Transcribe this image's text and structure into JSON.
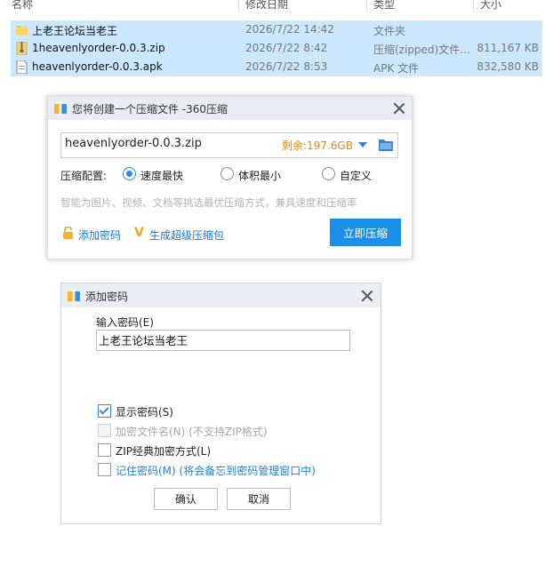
{
  "explorer": {
    "columns": [
      "名称",
      "修改日期",
      "类型",
      "大小"
    ],
    "rows": [
      {
        "name": "上老王论坛当老王",
        "date": "2026/7/22 14:42",
        "type": "文件夹",
        "size": "",
        "icon": "folder-icon"
      },
      {
        "name": "1heavenlyorder-0.0.3.zip",
        "date": "2026/7/22 8:42",
        "type": "压缩(zipped)文件...",
        "size": "811,167 KB",
        "icon": "zip-file-icon"
      },
      {
        "name": "heavenlyorder-0.0.3.apk",
        "date": "2026/7/22 8:53",
        "type": "APK 文件",
        "size": "832,580 KB",
        "icon": "apk-file-icon"
      }
    ]
  },
  "compress_dialog": {
    "title": "您将创建一个压缩文件 -360压缩",
    "filename": "heavenlyorder-0.0.3.zip",
    "remaining": "剩余:197.6GB",
    "config_label": "压缩配置:",
    "options": [
      "速度最快",
      "体积最小",
      "自定义"
    ],
    "selected_option": "速度最快",
    "hint": "智能为图片、视频、文档等挑选最优压缩方式，兼具速度和压缩率",
    "add_password": "添加密码",
    "super_package": "生成超级压缩包",
    "compress_now": "立即压缩",
    "accent_color": "#1b8fe8"
  },
  "password_dialog": {
    "title": "添加密码",
    "input_label": "输入密码(E)",
    "password_value": "上老王论坛当老王",
    "options": [
      {
        "label": "显示密码(S)",
        "checked": true,
        "disabled": false
      },
      {
        "label": "加密文件名(N) (不支持ZIP格式)",
        "checked": false,
        "disabled": true
      },
      {
        "label": "ZIP经典加密方式(L)",
        "checked": false,
        "disabled": false
      },
      {
        "label": "记住密码(M) (将会备忘到密码管理窗口中)",
        "checked": false,
        "disabled": false
      }
    ],
    "ok": "确认",
    "cancel": "取消"
  }
}
